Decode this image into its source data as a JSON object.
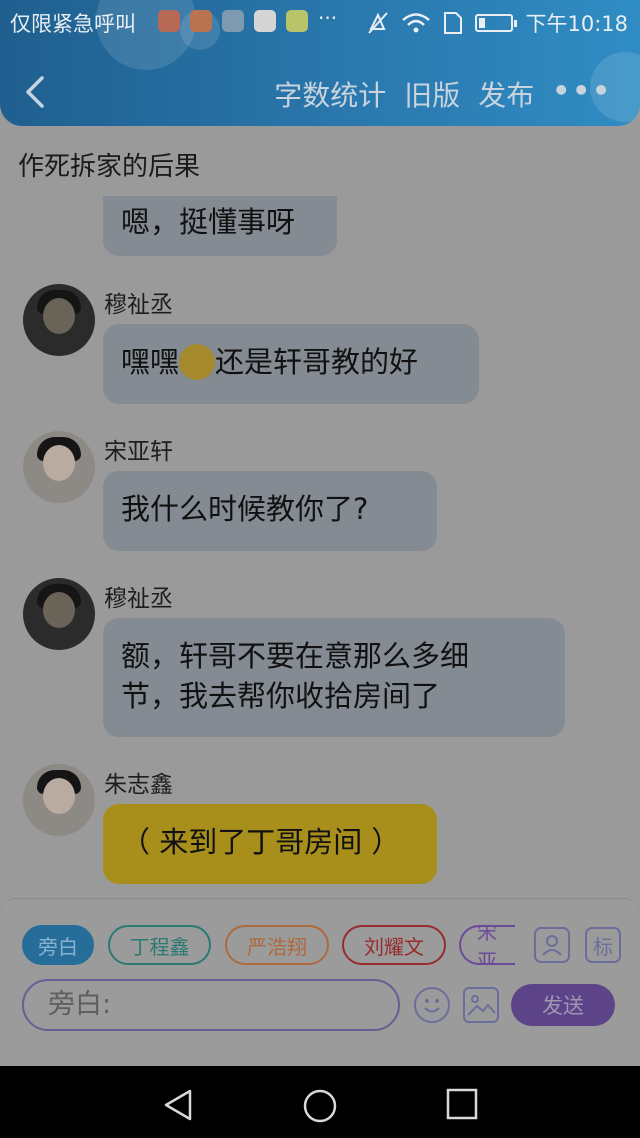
{
  "status_bar": {
    "carrier": "仅限紧急呼叫",
    "more": "···",
    "time": "下午10:18"
  },
  "nav": {
    "word_count": "字数统计",
    "old_version": "旧版",
    "publish": "发布",
    "more": "•••"
  },
  "document": {
    "title": "作死拆家的后果"
  },
  "messages": [
    {
      "name": "",
      "text": "嗯，挺懂事呀"
    },
    {
      "name": "穆祉丞",
      "text_before": "嘿嘿",
      "text_after": "还是轩哥教的好"
    },
    {
      "name": "宋亚轩",
      "text": "我什么时候教你了?"
    },
    {
      "name": "穆祉丞",
      "line1": "额，轩哥不要在意那么多细",
      "line2": "节，我去帮你收拾房间了"
    },
    {
      "name": "朱志鑫",
      "text": "（ 来到了丁哥房间 ）"
    }
  ],
  "composer": {
    "chips": [
      "旁白",
      "丁程鑫",
      "严浩翔",
      "刘耀文",
      "宋亚"
    ],
    "tag_icon_label": "标",
    "input_placeholder": "旁白:",
    "send_label": "发送"
  },
  "colors": {
    "header": "#2a78ad",
    "bubble": "#848b92",
    "gold_bubble": "#a88f1c",
    "send": "#5d4488"
  }
}
